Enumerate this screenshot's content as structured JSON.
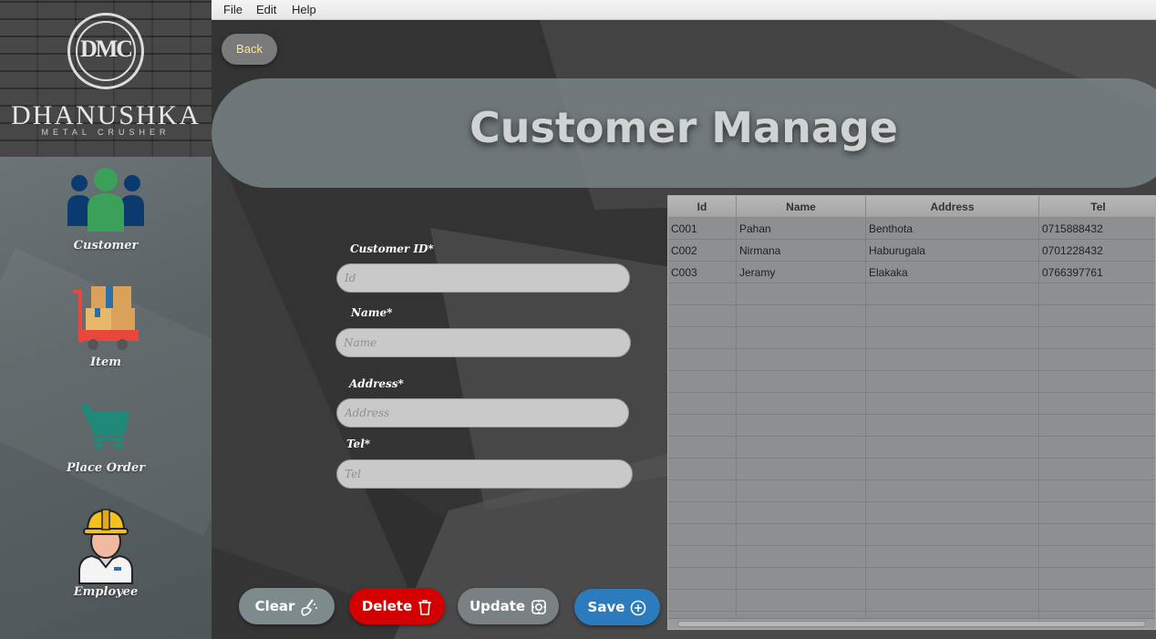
{
  "menu": [
    "File",
    "Edit",
    "Help"
  ],
  "back_label": "Back",
  "logo": {
    "monogram": "DMC",
    "name": "DHANUSHKA",
    "subtitle": "METAL CRUSHER"
  },
  "nav": [
    {
      "label": "Customer",
      "icon": "customer-icon"
    },
    {
      "label": "Item",
      "icon": "item-icon"
    },
    {
      "label": "Place Order",
      "icon": "cart-icon"
    },
    {
      "label": "Employee",
      "icon": "employee-icon"
    }
  ],
  "page_title": "Customer Manage",
  "form": {
    "customer_id": {
      "label": "Customer ID*",
      "placeholder": "Id",
      "value": ""
    },
    "name": {
      "label": "Name*",
      "placeholder": "Name",
      "value": ""
    },
    "address": {
      "label": "Address*",
      "placeholder": "Address",
      "value": ""
    },
    "tel": {
      "label": "Tel*",
      "placeholder": "Tel",
      "value": ""
    }
  },
  "buttons": {
    "clear": {
      "label": "Clear",
      "color": "#7d8b8f"
    },
    "delete": {
      "label": "Delete",
      "color": "#d40000"
    },
    "update": {
      "label": "Update",
      "color": "#7a8184"
    },
    "save": {
      "label": "Save",
      "color": "#2b7bbd"
    }
  },
  "table": {
    "columns": [
      "Id",
      "Name",
      "Address",
      "Tel"
    ],
    "rows": [
      [
        "C001",
        "Pahan",
        "Benthota",
        "0715888432"
      ],
      [
        "C002",
        "Nirmana",
        "Haburugala",
        "0701228432"
      ],
      [
        "C003",
        "Jeramy",
        "Elakaka",
        "0766397761"
      ]
    ]
  }
}
